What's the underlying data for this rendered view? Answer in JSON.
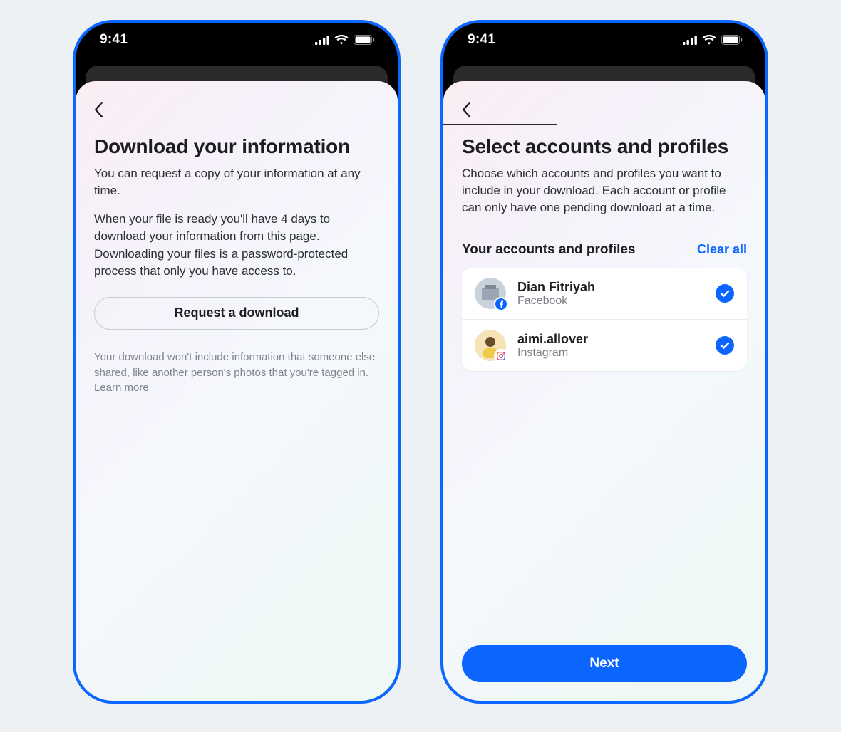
{
  "status_time": "9:41",
  "screen1": {
    "title": "Download your information",
    "desc1": "You can request a copy of your information at any time.",
    "desc2": "When your file is ready you'll have 4 days to download your information from this page. Downloading your files is a password-protected process that only you have access to.",
    "request_btn": "Request a download",
    "footnote": "Your download won't include information that someone else shared, like another person's photos that you're tagged in. Learn more"
  },
  "screen2": {
    "title": "Select accounts and profiles",
    "desc": "Choose which accounts and profiles you want to include in your download. Each account or profile can only have one pending download at a time.",
    "section_label": "Your accounts and profiles",
    "clear_all": "Clear all",
    "accounts": [
      {
        "name": "Dian Fitriyah",
        "platform": "Facebook"
      },
      {
        "name": "aimi.allover",
        "platform": "Instagram"
      }
    ],
    "next_btn": "Next"
  }
}
